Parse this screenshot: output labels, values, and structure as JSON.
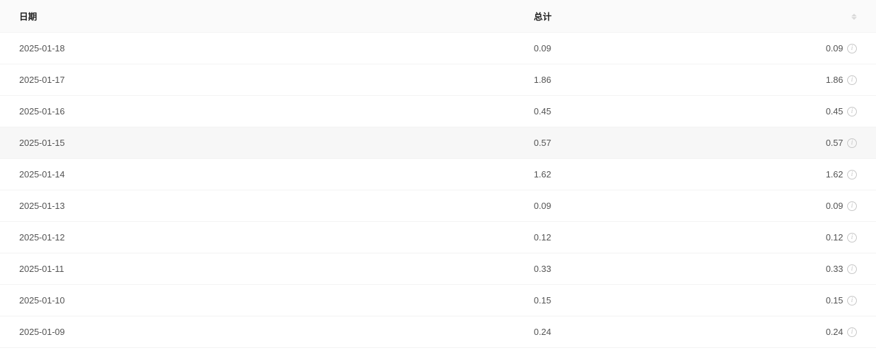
{
  "table": {
    "headers": {
      "date": "日期",
      "total": "总计",
      "value": ""
    },
    "rows": [
      {
        "date": "2025-01-18",
        "total": "0.09",
        "value": "0.09",
        "highlighted": false
      },
      {
        "date": "2025-01-17",
        "total": "1.86",
        "value": "1.86",
        "highlighted": false
      },
      {
        "date": "2025-01-16",
        "total": "0.45",
        "value": "0.45",
        "highlighted": false
      },
      {
        "date": "2025-01-15",
        "total": "0.57",
        "value": "0.57",
        "highlighted": true
      },
      {
        "date": "2025-01-14",
        "total": "1.62",
        "value": "1.62",
        "highlighted": false
      },
      {
        "date": "2025-01-13",
        "total": "0.09",
        "value": "0.09",
        "highlighted": false
      },
      {
        "date": "2025-01-12",
        "total": "0.12",
        "value": "0.12",
        "highlighted": false
      },
      {
        "date": "2025-01-11",
        "total": "0.33",
        "value": "0.33",
        "highlighted": false
      },
      {
        "date": "2025-01-10",
        "total": "0.15",
        "value": "0.15",
        "highlighted": false
      },
      {
        "date": "2025-01-09",
        "total": "0.24",
        "value": "0.24",
        "highlighted": false
      }
    ]
  }
}
